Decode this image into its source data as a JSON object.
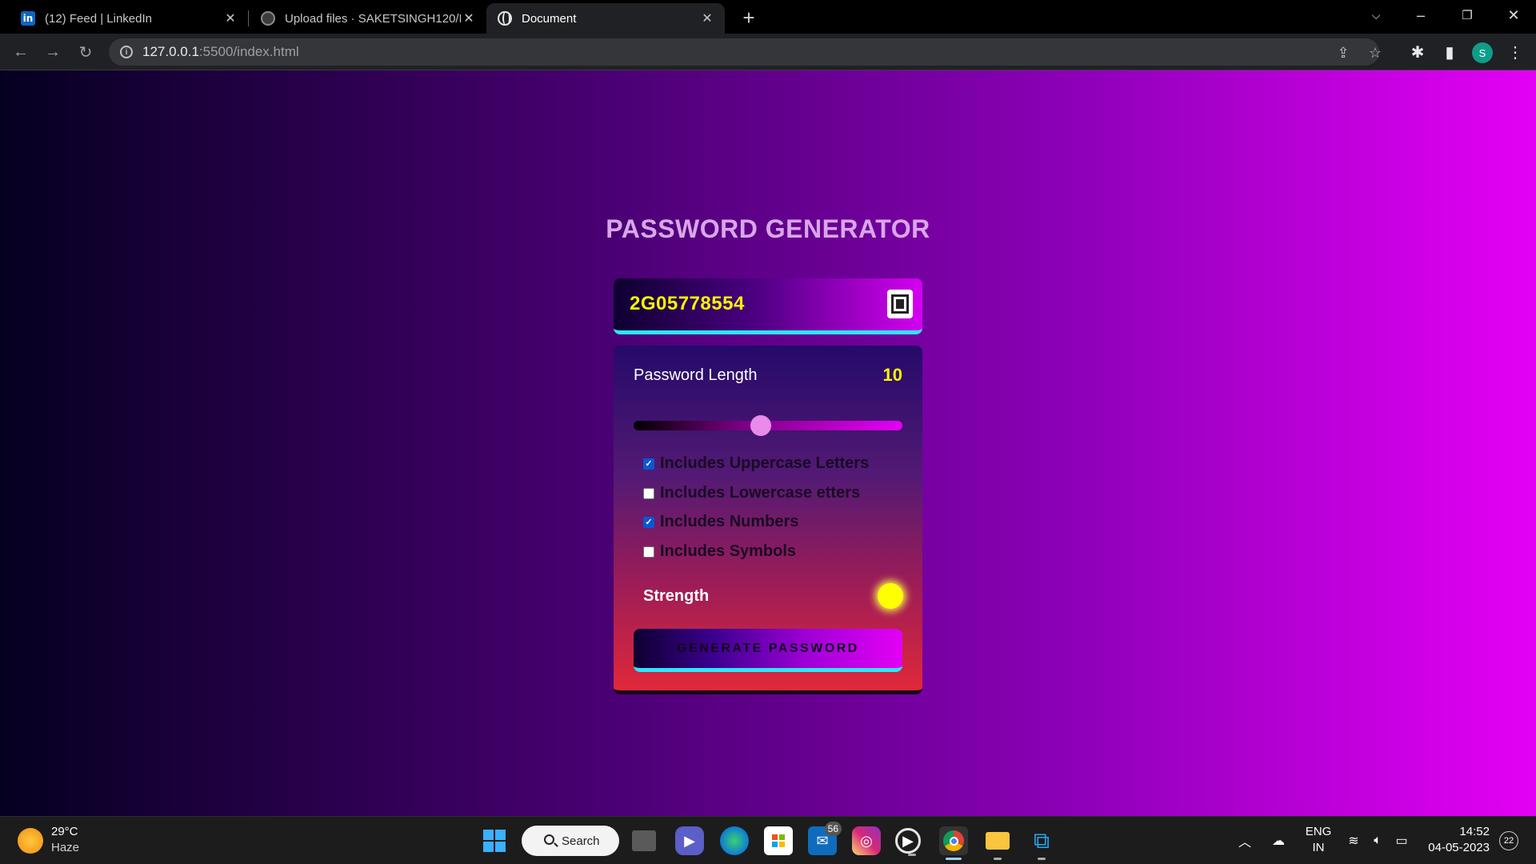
{
  "browser": {
    "tabs": [
      {
        "title": "(12) Feed | LinkedIn",
        "favicon": "linkedin-icon"
      },
      {
        "title": "Upload files · SAKETSINGH120/Pa",
        "favicon": "github-icon"
      },
      {
        "title": "Document",
        "favicon": "globe-icon",
        "active": true
      }
    ],
    "url_host": "127.0.0.1",
    "url_path": ":5500/index.html",
    "profile_initial": "S"
  },
  "app": {
    "title": "PASSWORD GENERATOR",
    "password": "2G05778554",
    "length_label": "Password Length",
    "length_value": "10",
    "slider": {
      "min": 1,
      "max": 20,
      "value": 10
    },
    "options": [
      {
        "label": "Includes Uppercase Letters",
        "checked": true
      },
      {
        "label": "Includes Lowercase etters",
        "checked": false
      },
      {
        "label": "Includes Numbers",
        "checked": true
      },
      {
        "label": "Includes Symbols",
        "checked": false
      }
    ],
    "strength_label": "Strength",
    "strength_color": "#ffff00",
    "generate_label": "GENERATE PASSWORD"
  },
  "taskbar": {
    "temperature": "29°C",
    "weather": "Haze",
    "search_label": "Search",
    "mail_badge": "56",
    "language": "ENG",
    "region": "IN",
    "time": "14:52",
    "date": "04-05-2023",
    "notifications": "22"
  }
}
